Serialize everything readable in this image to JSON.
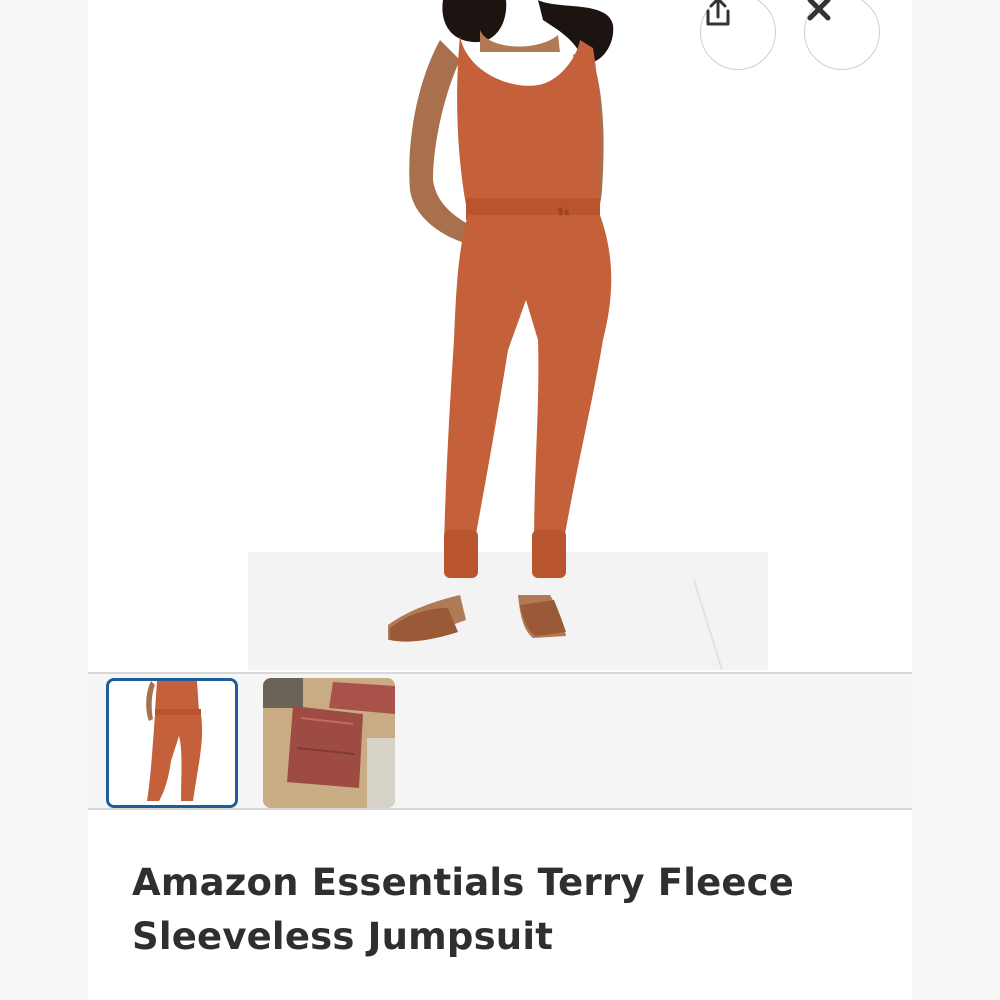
{
  "header": {
    "share_icon": "share-icon",
    "close_icon": "close-icon"
  },
  "gallery": {
    "main_image": "product-photo-model-jumpsuit",
    "thumbnails": [
      {
        "name": "thumbnail-model-photo",
        "selected": true
      },
      {
        "name": "thumbnail-folded-product",
        "selected": false
      }
    ],
    "accent_color": "#1f5d9a"
  },
  "product": {
    "title": "Amazon Essentials Terry Fleece Sleeveless Jumpsuit",
    "color_swatch": "#c4603a"
  }
}
